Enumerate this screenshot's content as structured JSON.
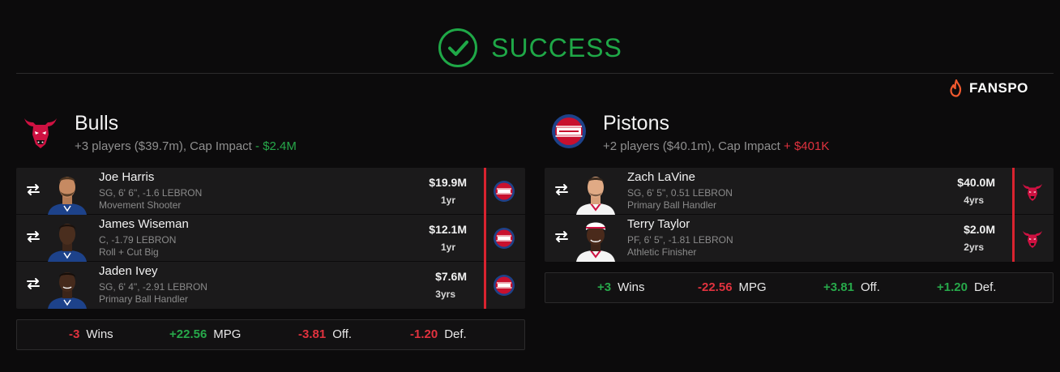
{
  "header": {
    "status": "SUCCESS",
    "brand": "FANSPO"
  },
  "colors": {
    "success": "#1fa847",
    "positive": "#27a84a",
    "negative": "#e0323e",
    "accent_bar": "#d9232f",
    "background": "#0c0b0c"
  },
  "teams": [
    {
      "name": "Bulls",
      "logo": "bulls-logo",
      "summary": "+3 players ($39.7m), Cap Impact",
      "impact": "- $2.4M",
      "players": [
        {
          "name": "Joe Harris",
          "meta": "SG, 6' 6\", -1.6 LEBRON",
          "role": "Movement Shooter",
          "salary": "$19.9M",
          "years": "1yr",
          "to": "pistons-logo"
        },
        {
          "name": "James Wiseman",
          "meta": "C, -1.79 LEBRON",
          "role": "Roll + Cut Big",
          "salary": "$12.1M",
          "years": "1yr",
          "to": "pistons-logo"
        },
        {
          "name": "Jaden Ivey",
          "meta": "SG, 6' 4\", -2.91 LEBRON",
          "role": "Primary Ball Handler",
          "salary": "$7.6M",
          "years": "3yrs",
          "to": "pistons-logo"
        }
      ],
      "stats": [
        {
          "value": "-3",
          "label": "Wins",
          "sign": "neg"
        },
        {
          "value": "+22.56",
          "label": "MPG",
          "sign": "pos"
        },
        {
          "value": "-3.81",
          "label": "Off.",
          "sign": "neg"
        },
        {
          "value": "-1.20",
          "label": "Def.",
          "sign": "neg"
        }
      ]
    },
    {
      "name": "Pistons",
      "logo": "pistons-logo",
      "summary": "+2 players ($40.1m), Cap Impact",
      "impact": "+ $401K",
      "players": [
        {
          "name": "Zach LaVine",
          "meta": "SG, 6' 5\", 0.51 LEBRON",
          "role": "Primary Ball Handler",
          "salary": "$40.0M",
          "years": "4yrs",
          "to": "bulls-logo"
        },
        {
          "name": "Terry Taylor",
          "meta": "PF, 6' 5\", -1.81 LEBRON",
          "role": "Athletic Finisher",
          "salary": "$2.0M",
          "years": "2yrs",
          "to": "bulls-logo"
        }
      ],
      "stats": [
        {
          "value": "+3",
          "label": "Wins",
          "sign": "pos"
        },
        {
          "value": "-22.56",
          "label": "MPG",
          "sign": "neg"
        },
        {
          "value": "+3.81",
          "label": "Off.",
          "sign": "pos"
        },
        {
          "value": "+1.20",
          "label": "Def.",
          "sign": "pos"
        }
      ]
    }
  ]
}
